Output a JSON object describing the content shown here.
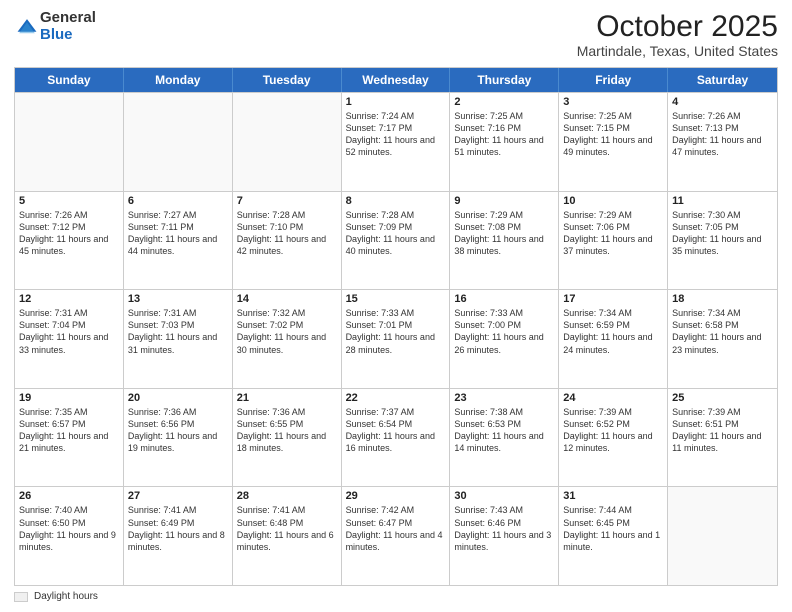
{
  "logo": {
    "general": "General",
    "blue": "Blue"
  },
  "header": {
    "title": "October 2025",
    "subtitle": "Martindale, Texas, United States"
  },
  "days_of_week": [
    "Sunday",
    "Monday",
    "Tuesday",
    "Wednesday",
    "Thursday",
    "Friday",
    "Saturday"
  ],
  "weeks": [
    [
      {
        "day": "",
        "info": ""
      },
      {
        "day": "",
        "info": ""
      },
      {
        "day": "",
        "info": ""
      },
      {
        "day": "1",
        "info": "Sunrise: 7:24 AM\nSunset: 7:17 PM\nDaylight: 11 hours\nand 52 minutes."
      },
      {
        "day": "2",
        "info": "Sunrise: 7:25 AM\nSunset: 7:16 PM\nDaylight: 11 hours\nand 51 minutes."
      },
      {
        "day": "3",
        "info": "Sunrise: 7:25 AM\nSunset: 7:15 PM\nDaylight: 11 hours\nand 49 minutes."
      },
      {
        "day": "4",
        "info": "Sunrise: 7:26 AM\nSunset: 7:13 PM\nDaylight: 11 hours\nand 47 minutes."
      }
    ],
    [
      {
        "day": "5",
        "info": "Sunrise: 7:26 AM\nSunset: 7:12 PM\nDaylight: 11 hours\nand 45 minutes."
      },
      {
        "day": "6",
        "info": "Sunrise: 7:27 AM\nSunset: 7:11 PM\nDaylight: 11 hours\nand 44 minutes."
      },
      {
        "day": "7",
        "info": "Sunrise: 7:28 AM\nSunset: 7:10 PM\nDaylight: 11 hours\nand 42 minutes."
      },
      {
        "day": "8",
        "info": "Sunrise: 7:28 AM\nSunset: 7:09 PM\nDaylight: 11 hours\nand 40 minutes."
      },
      {
        "day": "9",
        "info": "Sunrise: 7:29 AM\nSunset: 7:08 PM\nDaylight: 11 hours\nand 38 minutes."
      },
      {
        "day": "10",
        "info": "Sunrise: 7:29 AM\nSunset: 7:06 PM\nDaylight: 11 hours\nand 37 minutes."
      },
      {
        "day": "11",
        "info": "Sunrise: 7:30 AM\nSunset: 7:05 PM\nDaylight: 11 hours\nand 35 minutes."
      }
    ],
    [
      {
        "day": "12",
        "info": "Sunrise: 7:31 AM\nSunset: 7:04 PM\nDaylight: 11 hours\nand 33 minutes."
      },
      {
        "day": "13",
        "info": "Sunrise: 7:31 AM\nSunset: 7:03 PM\nDaylight: 11 hours\nand 31 minutes."
      },
      {
        "day": "14",
        "info": "Sunrise: 7:32 AM\nSunset: 7:02 PM\nDaylight: 11 hours\nand 30 minutes."
      },
      {
        "day": "15",
        "info": "Sunrise: 7:33 AM\nSunset: 7:01 PM\nDaylight: 11 hours\nand 28 minutes."
      },
      {
        "day": "16",
        "info": "Sunrise: 7:33 AM\nSunset: 7:00 PM\nDaylight: 11 hours\nand 26 minutes."
      },
      {
        "day": "17",
        "info": "Sunrise: 7:34 AM\nSunset: 6:59 PM\nDaylight: 11 hours\nand 24 minutes."
      },
      {
        "day": "18",
        "info": "Sunrise: 7:34 AM\nSunset: 6:58 PM\nDaylight: 11 hours\nand 23 minutes."
      }
    ],
    [
      {
        "day": "19",
        "info": "Sunrise: 7:35 AM\nSunset: 6:57 PM\nDaylight: 11 hours\nand 21 minutes."
      },
      {
        "day": "20",
        "info": "Sunrise: 7:36 AM\nSunset: 6:56 PM\nDaylight: 11 hours\nand 19 minutes."
      },
      {
        "day": "21",
        "info": "Sunrise: 7:36 AM\nSunset: 6:55 PM\nDaylight: 11 hours\nand 18 minutes."
      },
      {
        "day": "22",
        "info": "Sunrise: 7:37 AM\nSunset: 6:54 PM\nDaylight: 11 hours\nand 16 minutes."
      },
      {
        "day": "23",
        "info": "Sunrise: 7:38 AM\nSunset: 6:53 PM\nDaylight: 11 hours\nand 14 minutes."
      },
      {
        "day": "24",
        "info": "Sunrise: 7:39 AM\nSunset: 6:52 PM\nDaylight: 11 hours\nand 12 minutes."
      },
      {
        "day": "25",
        "info": "Sunrise: 7:39 AM\nSunset: 6:51 PM\nDaylight: 11 hours\nand 11 minutes."
      }
    ],
    [
      {
        "day": "26",
        "info": "Sunrise: 7:40 AM\nSunset: 6:50 PM\nDaylight: 11 hours\nand 9 minutes."
      },
      {
        "day": "27",
        "info": "Sunrise: 7:41 AM\nSunset: 6:49 PM\nDaylight: 11 hours\nand 8 minutes."
      },
      {
        "day": "28",
        "info": "Sunrise: 7:41 AM\nSunset: 6:48 PM\nDaylight: 11 hours\nand 6 minutes."
      },
      {
        "day": "29",
        "info": "Sunrise: 7:42 AM\nSunset: 6:47 PM\nDaylight: 11 hours\nand 4 minutes."
      },
      {
        "day": "30",
        "info": "Sunrise: 7:43 AM\nSunset: 6:46 PM\nDaylight: 11 hours\nand 3 minutes."
      },
      {
        "day": "31",
        "info": "Sunrise: 7:44 AM\nSunset: 6:45 PM\nDaylight: 11 hours\nand 1 minute."
      },
      {
        "day": "",
        "info": ""
      }
    ]
  ],
  "legend": {
    "box_label": "Daylight hours"
  }
}
